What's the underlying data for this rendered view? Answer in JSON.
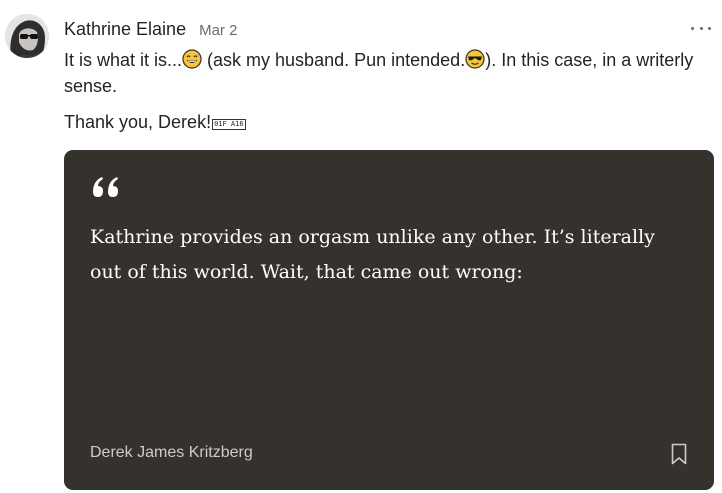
{
  "comment": {
    "author": "Kathrine Elaine",
    "date": "Mar 2",
    "line1_part1": "It is what it is...",
    "line1_part2": " (ask my husband. Pun intended.",
    "line1_part3": "). In this case, in a writerly sense.",
    "line2": "Thank you, Derek!",
    "glyph": "01F A16",
    "more_icon": "more-icon",
    "emoji_1": "grinning-sweat-emoji",
    "emoji_2": "sunglasses-emoji"
  },
  "quote_card": {
    "text": "Kathrine provides an orgasm unlike any other. It’s literally out of this world. Wait, that came out wrong:",
    "author": "Derek James Kritzberg",
    "quote_icon": "quote-mark-icon",
    "bookmark_icon": "bookmark-icon",
    "background": "#35312d"
  }
}
